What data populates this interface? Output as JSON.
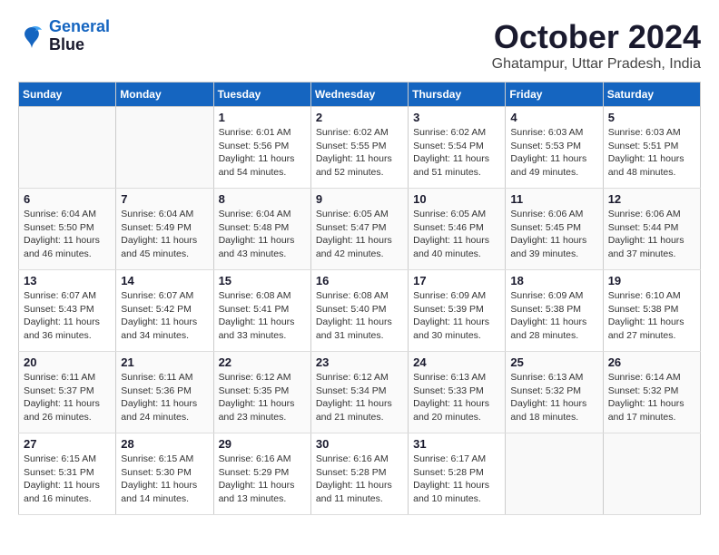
{
  "logo": {
    "line1": "General",
    "line2": "Blue"
  },
  "title": "October 2024",
  "subtitle": "Ghatampur, Uttar Pradesh, India",
  "headers": [
    "Sunday",
    "Monday",
    "Tuesday",
    "Wednesday",
    "Thursday",
    "Friday",
    "Saturday"
  ],
  "weeks": [
    [
      {
        "num": "",
        "info": ""
      },
      {
        "num": "",
        "info": ""
      },
      {
        "num": "1",
        "info": "Sunrise: 6:01 AM\nSunset: 5:56 PM\nDaylight: 11 hours and 54 minutes."
      },
      {
        "num": "2",
        "info": "Sunrise: 6:02 AM\nSunset: 5:55 PM\nDaylight: 11 hours and 52 minutes."
      },
      {
        "num": "3",
        "info": "Sunrise: 6:02 AM\nSunset: 5:54 PM\nDaylight: 11 hours and 51 minutes."
      },
      {
        "num": "4",
        "info": "Sunrise: 6:03 AM\nSunset: 5:53 PM\nDaylight: 11 hours and 49 minutes."
      },
      {
        "num": "5",
        "info": "Sunrise: 6:03 AM\nSunset: 5:51 PM\nDaylight: 11 hours and 48 minutes."
      }
    ],
    [
      {
        "num": "6",
        "info": "Sunrise: 6:04 AM\nSunset: 5:50 PM\nDaylight: 11 hours and 46 minutes."
      },
      {
        "num": "7",
        "info": "Sunrise: 6:04 AM\nSunset: 5:49 PM\nDaylight: 11 hours and 45 minutes."
      },
      {
        "num": "8",
        "info": "Sunrise: 6:04 AM\nSunset: 5:48 PM\nDaylight: 11 hours and 43 minutes."
      },
      {
        "num": "9",
        "info": "Sunrise: 6:05 AM\nSunset: 5:47 PM\nDaylight: 11 hours and 42 minutes."
      },
      {
        "num": "10",
        "info": "Sunrise: 6:05 AM\nSunset: 5:46 PM\nDaylight: 11 hours and 40 minutes."
      },
      {
        "num": "11",
        "info": "Sunrise: 6:06 AM\nSunset: 5:45 PM\nDaylight: 11 hours and 39 minutes."
      },
      {
        "num": "12",
        "info": "Sunrise: 6:06 AM\nSunset: 5:44 PM\nDaylight: 11 hours and 37 minutes."
      }
    ],
    [
      {
        "num": "13",
        "info": "Sunrise: 6:07 AM\nSunset: 5:43 PM\nDaylight: 11 hours and 36 minutes."
      },
      {
        "num": "14",
        "info": "Sunrise: 6:07 AM\nSunset: 5:42 PM\nDaylight: 11 hours and 34 minutes."
      },
      {
        "num": "15",
        "info": "Sunrise: 6:08 AM\nSunset: 5:41 PM\nDaylight: 11 hours and 33 minutes."
      },
      {
        "num": "16",
        "info": "Sunrise: 6:08 AM\nSunset: 5:40 PM\nDaylight: 11 hours and 31 minutes."
      },
      {
        "num": "17",
        "info": "Sunrise: 6:09 AM\nSunset: 5:39 PM\nDaylight: 11 hours and 30 minutes."
      },
      {
        "num": "18",
        "info": "Sunrise: 6:09 AM\nSunset: 5:38 PM\nDaylight: 11 hours and 28 minutes."
      },
      {
        "num": "19",
        "info": "Sunrise: 6:10 AM\nSunset: 5:38 PM\nDaylight: 11 hours and 27 minutes."
      }
    ],
    [
      {
        "num": "20",
        "info": "Sunrise: 6:11 AM\nSunset: 5:37 PM\nDaylight: 11 hours and 26 minutes."
      },
      {
        "num": "21",
        "info": "Sunrise: 6:11 AM\nSunset: 5:36 PM\nDaylight: 11 hours and 24 minutes."
      },
      {
        "num": "22",
        "info": "Sunrise: 6:12 AM\nSunset: 5:35 PM\nDaylight: 11 hours and 23 minutes."
      },
      {
        "num": "23",
        "info": "Sunrise: 6:12 AM\nSunset: 5:34 PM\nDaylight: 11 hours and 21 minutes."
      },
      {
        "num": "24",
        "info": "Sunrise: 6:13 AM\nSunset: 5:33 PM\nDaylight: 11 hours and 20 minutes."
      },
      {
        "num": "25",
        "info": "Sunrise: 6:13 AM\nSunset: 5:32 PM\nDaylight: 11 hours and 18 minutes."
      },
      {
        "num": "26",
        "info": "Sunrise: 6:14 AM\nSunset: 5:32 PM\nDaylight: 11 hours and 17 minutes."
      }
    ],
    [
      {
        "num": "27",
        "info": "Sunrise: 6:15 AM\nSunset: 5:31 PM\nDaylight: 11 hours and 16 minutes."
      },
      {
        "num": "28",
        "info": "Sunrise: 6:15 AM\nSunset: 5:30 PM\nDaylight: 11 hours and 14 minutes."
      },
      {
        "num": "29",
        "info": "Sunrise: 6:16 AM\nSunset: 5:29 PM\nDaylight: 11 hours and 13 minutes."
      },
      {
        "num": "30",
        "info": "Sunrise: 6:16 AM\nSunset: 5:28 PM\nDaylight: 11 hours and 11 minutes."
      },
      {
        "num": "31",
        "info": "Sunrise: 6:17 AM\nSunset: 5:28 PM\nDaylight: 11 hours and 10 minutes."
      },
      {
        "num": "",
        "info": ""
      },
      {
        "num": "",
        "info": ""
      }
    ]
  ]
}
